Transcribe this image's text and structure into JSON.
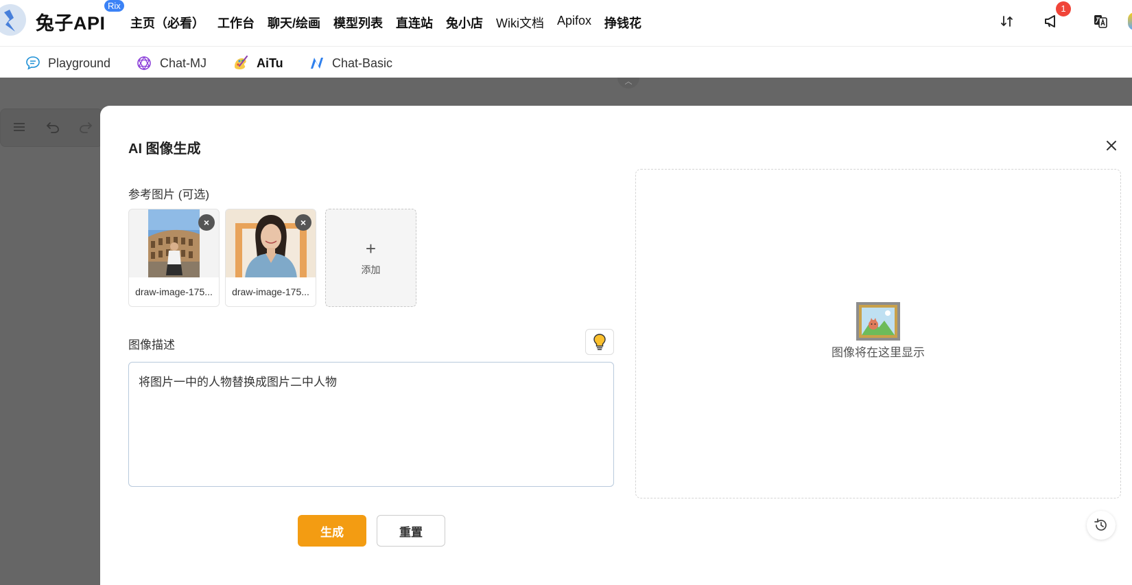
{
  "header": {
    "brand": "兔子API",
    "brand_badge": "Rix",
    "nav": [
      "主页（必看）",
      "工作台",
      "聊天/绘画",
      "模型列表",
      "直连站",
      "兔小店",
      "Wiki文档",
      "Apifox",
      "挣钱花"
    ],
    "notification_count": "1",
    "icons": [
      "swap-icon",
      "megaphone-icon",
      "translate-icon"
    ]
  },
  "subtabs": [
    {
      "label": "Playground",
      "icon": "chat-bubble-icon"
    },
    {
      "label": "Chat-MJ",
      "icon": "openai-icon"
    },
    {
      "label": "AiTu",
      "icon": "paint-palette-icon",
      "active": true
    },
    {
      "label": "Chat-Basic",
      "icon": "n-logo-icon"
    }
  ],
  "modal": {
    "title": "AI 图像生成",
    "ref_label": "参考图片 (可选)",
    "references": [
      {
        "caption": "draw-image-175..."
      },
      {
        "caption": "draw-image-175..."
      }
    ],
    "remove_symbol": "×",
    "add_plus": "+",
    "add_label": "添加",
    "desc_label": "图像描述",
    "prompt_value": "将图片一中的人物替换成图片二中人物",
    "generate_label": "生成",
    "reset_label": "重置",
    "preview_placeholder": "图像将在这里显示"
  },
  "colors": {
    "accent": "#f39c12",
    "overlay": "#666666",
    "badge": "#f04438"
  }
}
